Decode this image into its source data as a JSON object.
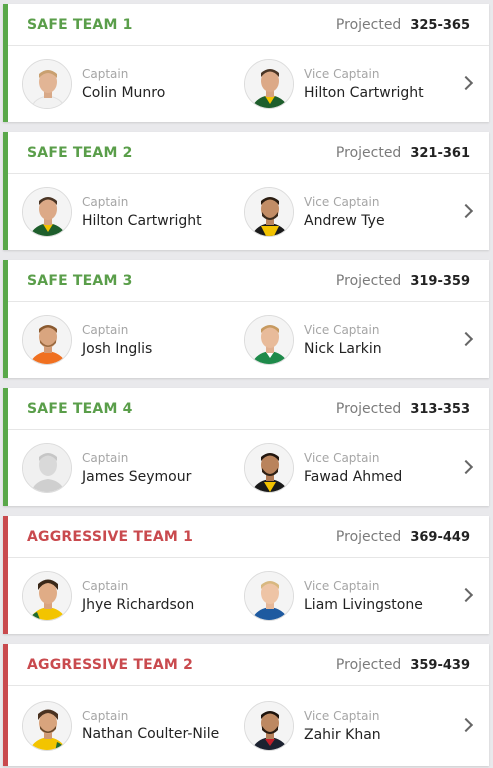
{
  "labels": {
    "projected": "Projected",
    "captain": "Captain",
    "vice_captain": "Vice Captain"
  },
  "colors": {
    "safe_accent": "#5aa84a",
    "aggressive_accent": "#c94a4e"
  },
  "teams": [
    {
      "name": "SAFE TEAM 1",
      "range": "325-365",
      "captain": "Colin Munro",
      "vice_captain": "Hilton Cartwright"
    },
    {
      "name": "SAFE TEAM 2",
      "range": "321-361",
      "captain": "Hilton Cartwright",
      "vice_captain": "Andrew Tye"
    },
    {
      "name": "SAFE TEAM 3",
      "range": "319-359",
      "captain": "Josh Inglis",
      "vice_captain": "Nick Larkin"
    },
    {
      "name": "SAFE TEAM 4",
      "range": "313-353",
      "captain": "James Seymour",
      "vice_captain": "Fawad Ahmed"
    },
    {
      "name": "AGGRESSIVE TEAM 1",
      "range": "369-449",
      "captain": "Jhye Richardson",
      "vice_captain": "Liam Livingstone"
    },
    {
      "name": "AGGRESSIVE TEAM 2",
      "range": "359-439",
      "captain": "Nathan Coulter-Nile",
      "vice_captain": "Zahir Khan"
    }
  ]
}
